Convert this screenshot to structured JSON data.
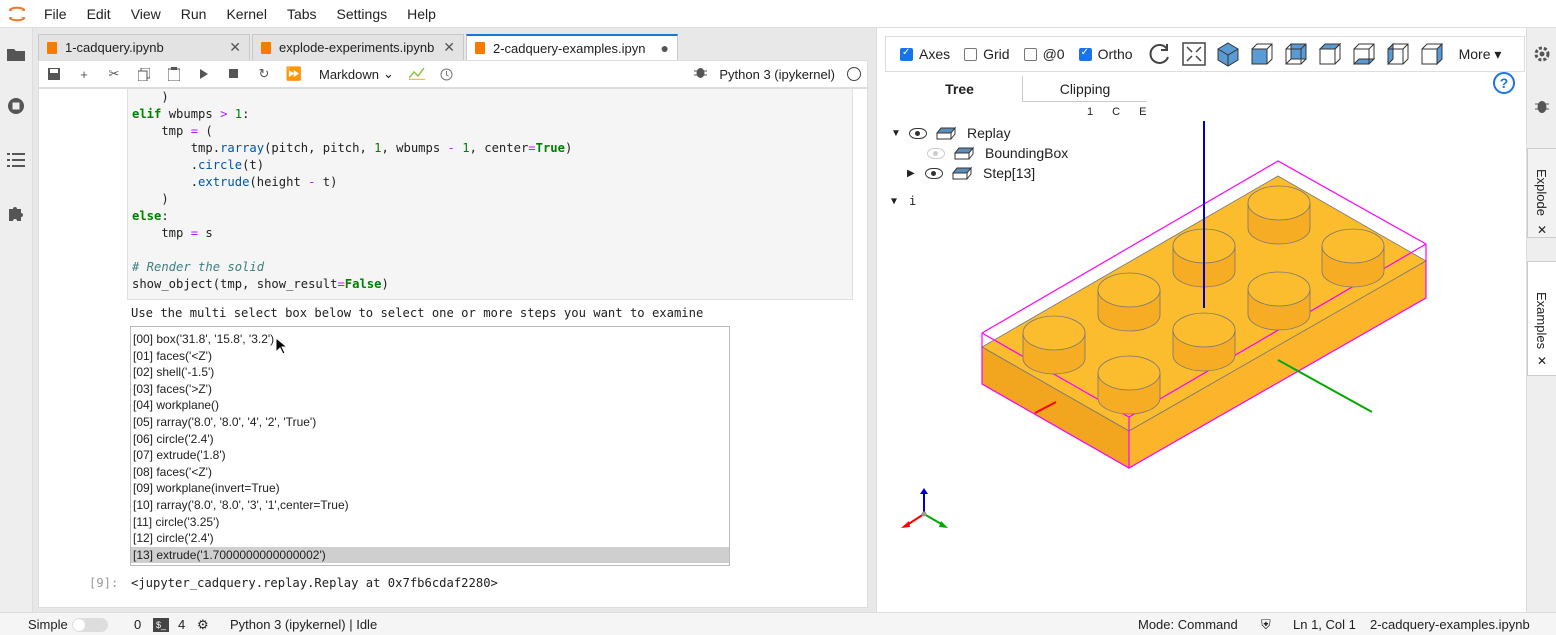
{
  "menubar": {
    "items": [
      "File",
      "Edit",
      "View",
      "Run",
      "Kernel",
      "Tabs",
      "Settings",
      "Help"
    ]
  },
  "tabs": [
    {
      "label": "1-cadquery.ipynb",
      "close": "✕"
    },
    {
      "label": "explode-experiments.ipynb",
      "close": "✕"
    },
    {
      "label": "2-cadquery-examples.ipyn",
      "close": "●"
    }
  ],
  "toolbar": {
    "cell_type": "Markdown",
    "kernel": "Python 3 (ipykernel)"
  },
  "code": [
    "    )",
    "elif wbumps > 1:",
    "    tmp = (",
    "        tmp.rarray(pitch, pitch, 1, wbumps - 1, center=True)",
    "        .circle(t)",
    "        .extrude(height - t)",
    "    )",
    "else:",
    "    tmp = s",
    "",
    "# Render the solid",
    "show_object(tmp, show_result=False)"
  ],
  "output_text": "Use the multi select box below to select one or more steps you want to examine",
  "steps": [
    "[00] box('31.8', '15.8', '3.2')",
    "[01] faces('<Z')",
    "[02] shell('-1.5')",
    "[03] faces('>Z')",
    "[04] workplane()",
    "[05] rarray('8.0', '8.0', '4', '2', 'True')",
    "[06] circle('2.4')",
    "[07] extrude('1.8')",
    "[08] faces('<Z')",
    "[09] workplane(invert=True)",
    "[10] rarray('8.0', '8.0', '3', '1',center=True)",
    "[11] circle('3.25')",
    "[12] circle('2.4')",
    "[13] extrude('1.7000000000000002')"
  ],
  "selected_step": 13,
  "out_prompt": "[9]:",
  "out_repr": "<jupyter_cadquery.replay.Replay at 0x7fb6cdaf2280>",
  "viewer": {
    "axes_label": "Axes",
    "axes_checked": true,
    "grid_label": "Grid",
    "grid_checked": false,
    "at0_label": "@0",
    "at0_checked": false,
    "ortho_label": "Ortho",
    "ortho_checked": true,
    "more_label": "More ▾",
    "help": "?",
    "tab_tree": "Tree",
    "tab_clipping": "Clipping",
    "tree_cols": "1 C E",
    "tree": {
      "replay": "Replay",
      "bbox": "BoundingBox",
      "step": "Step[13]",
      "i": "i"
    },
    "colors": {
      "part": "#fbbc2e",
      "bbox": "#ff00ff",
      "x_axis": "#ff0000",
      "y_axis": "#00aa00",
      "z_axis": "#0000cc"
    }
  },
  "rightbar": {
    "tab1": "Explode",
    "tab2": "Examples",
    "close": "✕"
  },
  "status": {
    "mode_label": "Simple",
    "n1": "0",
    "n2": "4",
    "kernel": "Python 3 (ipykernel) | Idle",
    "mode": "Mode: Command",
    "position": "Ln 1, Col 1",
    "file": "2-cadquery-examples.ipynb"
  }
}
